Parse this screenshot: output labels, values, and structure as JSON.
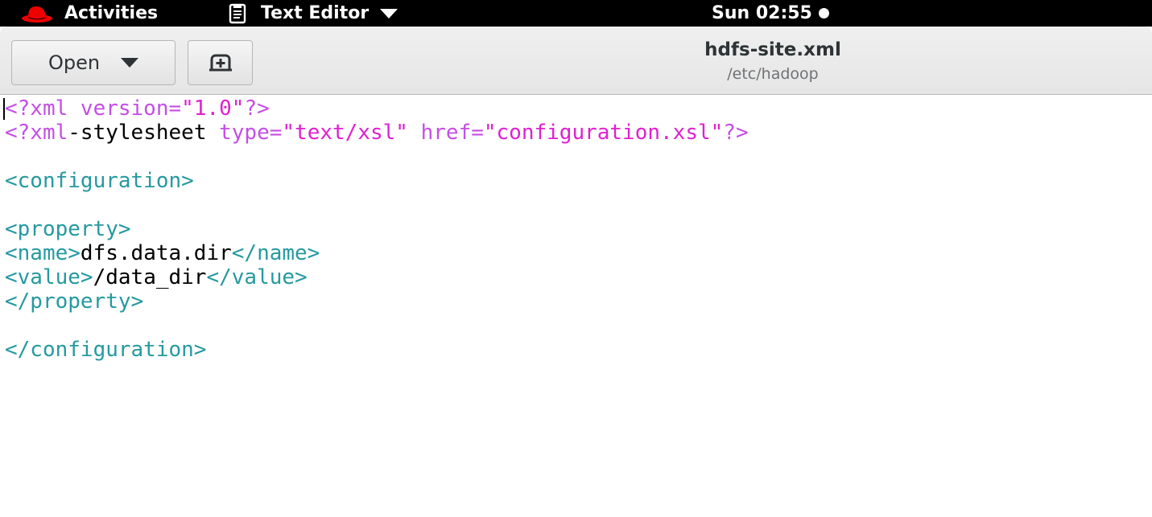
{
  "topbar": {
    "activities_label": "Activities",
    "app_menu_label": "Text Editor",
    "clock": "Sun 02:55"
  },
  "headerbar": {
    "open_label": "Open",
    "title": "hdfs-site.xml",
    "subtitle": "/etc/hadoop"
  },
  "editor": {
    "lines": [
      [
        {
          "t": "<?xml version=",
          "c": "pi"
        },
        {
          "t": "\"1.0\"",
          "c": "str"
        },
        {
          "t": "?>",
          "c": "pi"
        }
      ],
      [
        {
          "t": "<?xml",
          "c": "pi"
        },
        {
          "t": "-stylesheet ",
          "c": "txt"
        },
        {
          "t": "type=",
          "c": "pi"
        },
        {
          "t": "\"text/xsl\"",
          "c": "str"
        },
        {
          "t": " href=",
          "c": "pi"
        },
        {
          "t": "\"configuration.xsl\"",
          "c": "str"
        },
        {
          "t": "?>",
          "c": "pi"
        }
      ],
      [],
      [
        {
          "t": "<configuration>",
          "c": "tag"
        }
      ],
      [],
      [
        {
          "t": "<property>",
          "c": "tag"
        }
      ],
      [
        {
          "t": "<name>",
          "c": "tag"
        },
        {
          "t": "dfs.data.dir",
          "c": "txt"
        },
        {
          "t": "</name>",
          "c": "tag"
        }
      ],
      [
        {
          "t": "<value>",
          "c": "tag"
        },
        {
          "t": "/data_dir",
          "c": "txt"
        },
        {
          "t": "</value>",
          "c": "tag"
        }
      ],
      [
        {
          "t": "</property>",
          "c": "tag"
        }
      ],
      [],
      [
        {
          "t": "</configuration>",
          "c": "tag"
        }
      ]
    ]
  },
  "colors": {
    "processing_instruction": "#c44ee6",
    "string": "#e020d0",
    "tag": "#249aa0",
    "text": "#000000",
    "topbar_bg": "#000000",
    "redhat_red": "#ee0000"
  },
  "icons": {
    "activities": "redhat-logo-icon",
    "app_menu": "text-editor-icon",
    "app_menu_caret": "chevron-down-icon",
    "status": "status-dot-icon",
    "open_chevron": "chevron-down-icon",
    "new_document": "new-document-icon"
  }
}
